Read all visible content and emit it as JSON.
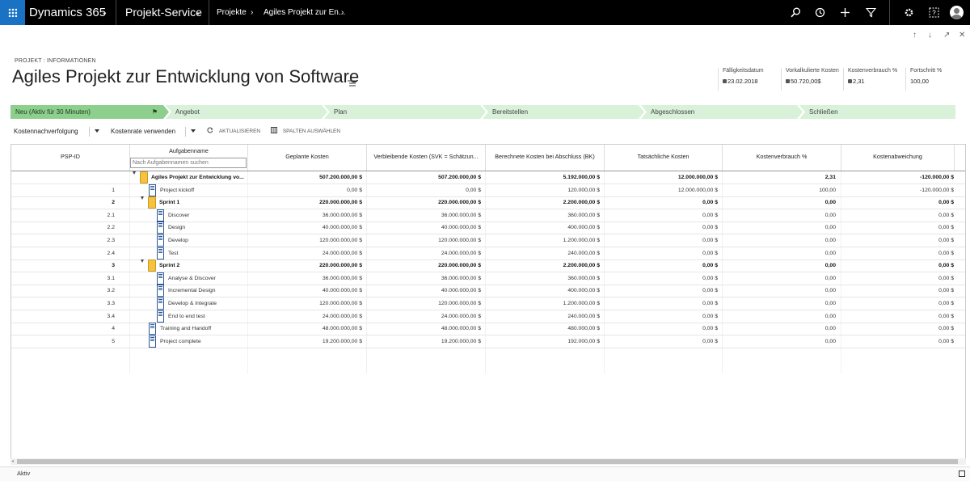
{
  "topnav": {
    "brand": "Dynamics 365",
    "app": "Projekt-Service",
    "crumbs": [
      "Projekte",
      "Agiles Projekt zur En..."
    ]
  },
  "icons": {
    "waffle": "app-launcher-icon",
    "search": "search-icon",
    "recent": "history-icon",
    "new": "plus-icon",
    "filter": "filter-icon",
    "settings": "gear-icon",
    "help": "help-icon",
    "user": "avatar"
  },
  "window_controls": [
    "↑",
    "↓",
    "↗",
    "✕"
  ],
  "header": {
    "entity_label": "PROJEKT : INFORMATIONEN",
    "title": "Agiles Projekt zur Entwicklung von Software",
    "fields": [
      {
        "label": "Fälligkeitsdatum",
        "value": "23.02.2018",
        "locked": true
      },
      {
        "label": "Vorkalkulierte Kosten",
        "value": "50.720,00$",
        "locked": true
      },
      {
        "label": "Kostenverbrauch %",
        "value": "2,31",
        "locked": true
      },
      {
        "label": "Fortschritt %",
        "value": "100,00",
        "locked": false
      }
    ]
  },
  "bpf": {
    "stages": [
      "Neu (Aktiv für 30 Minuten)",
      "Angebot",
      "Plan",
      "Bereitstellen",
      "Abgeschlossen",
      "Schließen"
    ],
    "active_color": "#8dcf8d",
    "stage_color": "#d9f0d9"
  },
  "toolbar": {
    "view1": "Kostennachverfolgung",
    "view2": "Kostenrate verwenden",
    "refresh": "AKTUALISIEREN",
    "columns": "SPALTEN AUSWÄHLEN"
  },
  "grid": {
    "headers": {
      "psp": "PSP-ID",
      "name": "Aufgabenname",
      "planned": "Geplante Kosten",
      "remaining": "Verbleibende Kosten (SVK = Schätzun...",
      "eac": "Berechnete Kosten bei Abschluss (BK)",
      "actual": "Tatsächliche Kosten",
      "consumption": "Kostenverbrauch %",
      "variance": "Kostenabweichung"
    },
    "search_placeholder": "Nach Aufgabennamen suchen",
    "rows": [
      {
        "id": "",
        "name": "Agiles Projekt zur Entwicklung vo...",
        "planned": "507.200.000,00 $",
        "remaining": "507.200.000,00 $",
        "eac": "5.192.000,00 $",
        "actual": "12.000.000,00 $",
        "consumption": "2,31",
        "variance": "-120.000,00 $"
      },
      {
        "id": "1",
        "name": "Project kickoff",
        "planned": "0,00 $",
        "remaining": "0,00 $",
        "eac": "120.000,00 $",
        "actual": "12.000.000,00 $",
        "consumption": "100,00",
        "variance": "-120.000,00 $"
      },
      {
        "id": "2",
        "name": "Sprint 1",
        "planned": "220.000.000,00 $",
        "remaining": "220.000.000,00 $",
        "eac": "2.200.000,00 $",
        "actual": "0,00 $",
        "consumption": "0,00",
        "variance": "0,00 $"
      },
      {
        "id": "2.1",
        "name": "Discover",
        "planned": "36.000.000,00 $",
        "remaining": "36.000.000,00 $",
        "eac": "360.000,00 $",
        "actual": "0,00 $",
        "consumption": "0,00",
        "variance": "0,00 $"
      },
      {
        "id": "2.2",
        "name": "Design",
        "planned": "40.000.000,00 $",
        "remaining": "40.000.000,00 $",
        "eac": "400.000,00 $",
        "actual": "0,00 $",
        "consumption": "0,00",
        "variance": "0,00 $"
      },
      {
        "id": "2.3",
        "name": "Develop",
        "planned": "120.000.000,00 $",
        "remaining": "120.000.000,00 $",
        "eac": "1.200.000,00 $",
        "actual": "0,00 $",
        "consumption": "0,00",
        "variance": "0,00 $"
      },
      {
        "id": "2.4",
        "name": "Test",
        "planned": "24.000.000,00 $",
        "remaining": "24.000.000,00 $",
        "eac": "240.000,00 $",
        "actual": "0,00 $",
        "consumption": "0,00",
        "variance": "0,00 $"
      },
      {
        "id": "3",
        "name": "Sprint 2",
        "planned": "220.000.000,00 $",
        "remaining": "220.000.000,00 $",
        "eac": "2.200.000,00 $",
        "actual": "0,00 $",
        "consumption": "0,00",
        "variance": "0,00 $"
      },
      {
        "id": "3.1",
        "name": "Analyse & Discover",
        "planned": "36.000.000,00 $",
        "remaining": "36.000.000,00 $",
        "eac": "360.000,00 $",
        "actual": "0,00 $",
        "consumption": "0,00",
        "variance": "0,00 $"
      },
      {
        "id": "3.2",
        "name": "Incremental Design",
        "planned": "40.000.000,00 $",
        "remaining": "40.000.000,00 $",
        "eac": "400.000,00 $",
        "actual": "0,00 $",
        "consumption": "0,00",
        "variance": "0,00 $"
      },
      {
        "id": "3.3",
        "name": "Develop & Integrate",
        "planned": "120.000.000,00 $",
        "remaining": "120.000.000,00 $",
        "eac": "1.200.000,00 $",
        "actual": "0,00 $",
        "consumption": "0,00",
        "variance": "0,00 $"
      },
      {
        "id": "3.4",
        "name": "End to end test",
        "planned": "24.000.000,00 $",
        "remaining": "24.000.000,00 $",
        "eac": "240.000,00 $",
        "actual": "0,00 $",
        "consumption": "0,00",
        "variance": "0,00 $"
      },
      {
        "id": "4",
        "name": "Training and Handoff",
        "planned": "48.000.000,00 $",
        "remaining": "48.000.000,00 $",
        "eac": "480.000,00 $",
        "actual": "0,00 $",
        "consumption": "0,00",
        "variance": "0,00 $"
      },
      {
        "id": "5",
        "name": "Project complete",
        "planned": "19.200.000,00 $",
        "remaining": "19.200.000,00 $",
        "eac": "192.000,00 $",
        "actual": "0,00 $",
        "consumption": "0,00",
        "variance": "0,00 $"
      }
    ]
  },
  "status": {
    "text": "Aktiv"
  }
}
